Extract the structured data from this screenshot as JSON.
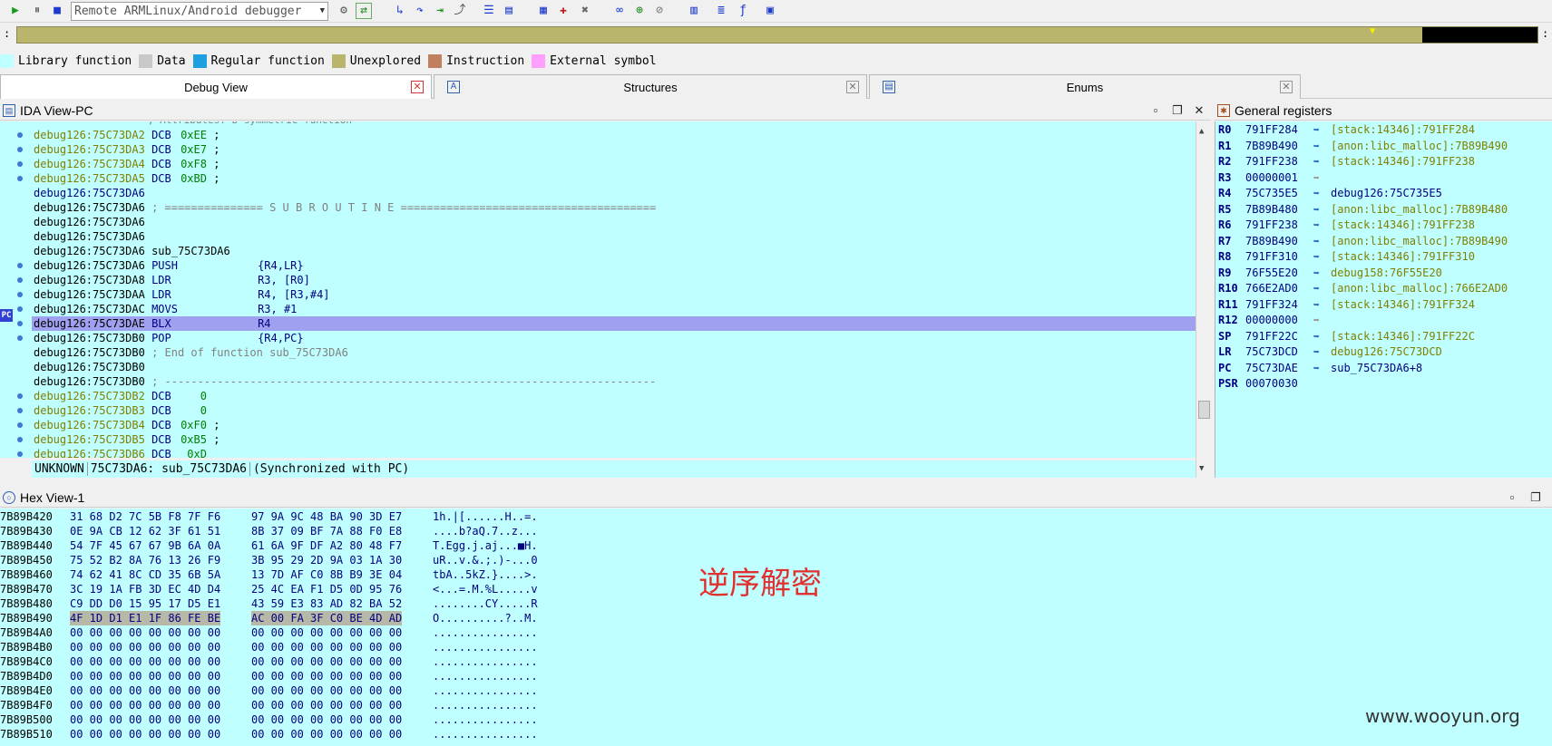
{
  "toolbar": {
    "debugger": "Remote ARMLinux/Android debugger"
  },
  "legend": [
    {
      "label": "Library function",
      "color": "#c0ffff"
    },
    {
      "label": "Data",
      "color": "#c8c8c8"
    },
    {
      "label": "Regular function",
      "color": "#1ea0e0"
    },
    {
      "label": "Unexplored",
      "color": "#b9b56c"
    },
    {
      "label": "Instruction",
      "color": "#c08060"
    },
    {
      "label": "External symbol",
      "color": "#ffa0ff"
    }
  ],
  "tabs": [
    {
      "label": "Debug View",
      "active": true
    },
    {
      "label": "Structures",
      "active": false
    },
    {
      "label": "Enums",
      "active": false
    }
  ],
  "ida_view": {
    "title": "IDA View-PC",
    "pc_badge": "PC",
    "lines": [
      {
        "addr": "debug126:75C73DA2",
        "mn": "DCB",
        "op": "0xEE",
        "tail": " ;",
        "style": "olive",
        "dot": true
      },
      {
        "addr": "debug126:75C73DA3",
        "mn": "DCB",
        "op": "0xE7",
        "tail": " ;",
        "style": "olive",
        "dot": true
      },
      {
        "addr": "debug126:75C73DA4",
        "mn": "DCB",
        "op": "0xF8",
        "tail": " ;",
        "style": "olive",
        "dot": true
      },
      {
        "addr": "debug126:75C73DA5",
        "mn": "DCB",
        "op": "0xBD",
        "tail": " ;",
        "style": "olive",
        "dot": true
      },
      {
        "addr": "debug126:75C73DA6",
        "mn": "",
        "op": "",
        "tail": "",
        "style": "dark-addr",
        "dot": false
      },
      {
        "addr": "debug126:75C73DA6",
        "comment": "; =============== S U B R O U T I N E =======================================",
        "style": "black",
        "dot": false
      },
      {
        "addr": "debug126:75C73DA6",
        "mn": "",
        "op": "",
        "tail": "",
        "style": "black",
        "dot": false
      },
      {
        "addr": "debug126:75C73DA6",
        "mn": "",
        "op": "",
        "tail": "",
        "style": "black",
        "dot": false
      },
      {
        "addr": "debug126:75C73DA6",
        "label": "sub_75C73DA6",
        "style": "black",
        "dot": false
      },
      {
        "addr": "debug126:75C73DA6",
        "mn": "PUSH",
        "op": "{R4,LR}",
        "style": "black",
        "dot": true
      },
      {
        "addr": "debug126:75C73DA8",
        "mn": "LDR",
        "op": "R3, [R0]",
        "style": "black",
        "dot": true
      },
      {
        "addr": "debug126:75C73DAA",
        "mn": "LDR",
        "op": "R4, [R3,#4]",
        "style": "black",
        "dot": true
      },
      {
        "addr": "debug126:75C73DAC",
        "mn": "MOVS",
        "op": "R3, #1",
        "style": "black",
        "dot": true
      },
      {
        "addr": "debug126:75C73DAE",
        "mn": "BLX",
        "op": "R4",
        "style": "black",
        "dot": true,
        "pc": true
      },
      {
        "addr": "debug126:75C73DB0",
        "mn": "POP",
        "op": "{R4,PC}",
        "style": "black",
        "dot": true
      },
      {
        "addr": "debug126:75C73DB0",
        "comment": "; End of function sub_75C73DA6",
        "style": "black",
        "dot": false
      },
      {
        "addr": "debug126:75C73DB0",
        "mn": "",
        "op": "",
        "tail": "",
        "style": "black",
        "dot": false
      },
      {
        "addr": "debug126:75C73DB0",
        "comment": "; ---------------------------------------------------------------------------",
        "style": "black",
        "dot": false
      },
      {
        "addr": "debug126:75C73DB2",
        "mn": "DCB",
        "op": "   0",
        "tail": "",
        "style": "olive",
        "dot": true
      },
      {
        "addr": "debug126:75C73DB3",
        "mn": "DCB",
        "op": "   0",
        "tail": "",
        "style": "olive",
        "dot": true
      },
      {
        "addr": "debug126:75C73DB4",
        "mn": "DCB",
        "op": "0xF0",
        "tail": " ;",
        "style": "olive",
        "dot": true
      },
      {
        "addr": "debug126:75C73DB5",
        "mn": "DCB",
        "op": "0xB5",
        "tail": " ;",
        "style": "olive",
        "dot": true
      },
      {
        "addr": "debug126:75C73DB6",
        "mn": "DCB",
        "op": " 0xD",
        "tail": "",
        "style": "olive",
        "dot": true
      }
    ],
    "status": {
      "seg": "UNKNOWN",
      "loc": "75C73DA6: sub_75C73DA6",
      "sync": "(Synchronized with PC)"
    }
  },
  "registers": {
    "title": "General registers",
    "rows": [
      {
        "name": "R0",
        "value": "791FF284",
        "target": "[stack:14346]:791FF284",
        "style": "olive"
      },
      {
        "name": "R1",
        "value": "7B89B490",
        "target": "[anon:libc_malloc]:7B89B490",
        "style": "olive"
      },
      {
        "name": "R2",
        "value": "791FF238",
        "target": "[stack:14346]:791FF238",
        "style": "olive"
      },
      {
        "name": "R3",
        "value": "00000001",
        "target": "",
        "style": "grey"
      },
      {
        "name": "R4",
        "value": "75C735E5",
        "target": "debug126:75C735E5",
        "style": "dark"
      },
      {
        "name": "R5",
        "value": "7B89B480",
        "target": "[anon:libc_malloc]:7B89B480",
        "style": "olive"
      },
      {
        "name": "R6",
        "value": "791FF238",
        "target": "[stack:14346]:791FF238",
        "style": "olive"
      },
      {
        "name": "R7",
        "value": "7B89B490",
        "target": "[anon:libc_malloc]:7B89B490",
        "style": "olive"
      },
      {
        "name": "R8",
        "value": "791FF310",
        "target": "[stack:14346]:791FF310",
        "style": "olive"
      },
      {
        "name": "R9",
        "value": "76F55E20",
        "target": "debug158:76F55E20",
        "style": "olive"
      },
      {
        "name": "R10",
        "value": "766E2AD0",
        "target": "[anon:libc_malloc]:766E2AD0",
        "style": "olive"
      },
      {
        "name": "R11",
        "value": "791FF324",
        "target": "[stack:14346]:791FF324",
        "style": "olive"
      },
      {
        "name": "R12",
        "value": "00000000",
        "target": "",
        "style": "grey"
      },
      {
        "name": "SP",
        "value": "791FF22C",
        "target": "[stack:14346]:791FF22C",
        "style": "olive"
      },
      {
        "name": "LR",
        "value": "75C73DCD",
        "target": "debug126:75C73DCD",
        "style": "olive"
      },
      {
        "name": "PC",
        "value": "75C73DAE",
        "target": "sub_75C73DA6+8",
        "style": "dark"
      },
      {
        "name": "PSR",
        "value": "00070030",
        "target": "",
        "style": "none"
      }
    ]
  },
  "hex_view": {
    "title": "Hex View-1",
    "rows": [
      {
        "addr": "7B89B420",
        "h1": "31 68 D2 7C 5B F8 7F F6",
        "h2": "97 9A 9C 48 BA 90 3D E7",
        "ascii": "1h.|[......H..=."
      },
      {
        "addr": "7B89B430",
        "h1": "0E 9A CB 12 62 3F 61 51",
        "h2": "8B 37 09 BF 7A 88 F0 E8",
        "ascii": "....b?aQ.7..z..."
      },
      {
        "addr": "7B89B440",
        "h1": "54 7F 45 67 67 9B 6A 0A",
        "h2": "61 6A 9F DF A2 80 48 F7",
        "ascii": "T.Egg.j.aj...■H."
      },
      {
        "addr": "7B89B450",
        "h1": "75 52 B2 8A 76 13 26 F9",
        "h2": "3B 95 29 2D 9A 03 1A 30",
        "ascii": "uR..v.&.;.)-...0"
      },
      {
        "addr": "7B89B460",
        "h1": "74 62 41 8C CD 35 6B 5A",
        "h2": "13 7D AF C0 8B B9 3E 04",
        "ascii": "tbA..5kZ.}....>."
      },
      {
        "addr": "7B89B470",
        "h1": "3C 19 1A FB 3D EC 4D D4",
        "h2": "25 4C EA F1 D5 0D 95 76",
        "ascii": "<...=.M.%L.....v"
      },
      {
        "addr": "7B89B480",
        "h1": "C9 DD D0 15 95 17 D5 E1",
        "h2": "43 59 E3 83 AD 82 BA 52",
        "ascii": "........CY.....R"
      },
      {
        "addr": "7B89B490",
        "h1": "4F 1D D1 E1 1F 86 FE BE",
        "h2": "AC 00 FA 3F C0 BE 4D AD",
        "ascii": "O..........?..M.",
        "selected": true
      },
      {
        "addr": "7B89B4A0",
        "h1": "00 00 00 00 00 00 00 00",
        "h2": "00 00 00 00 00 00 00 00",
        "ascii": "................"
      },
      {
        "addr": "7B89B4B0",
        "h1": "00 00 00 00 00 00 00 00",
        "h2": "00 00 00 00 00 00 00 00",
        "ascii": "................"
      },
      {
        "addr": "7B89B4C0",
        "h1": "00 00 00 00 00 00 00 00",
        "h2": "00 00 00 00 00 00 00 00",
        "ascii": "................"
      },
      {
        "addr": "7B89B4D0",
        "h1": "00 00 00 00 00 00 00 00",
        "h2": "00 00 00 00 00 00 00 00",
        "ascii": "................"
      },
      {
        "addr": "7B89B4E0",
        "h1": "00 00 00 00 00 00 00 00",
        "h2": "00 00 00 00 00 00 00 00",
        "ascii": "................"
      },
      {
        "addr": "7B89B4F0",
        "h1": "00 00 00 00 00 00 00 00",
        "h2": "00 00 00 00 00 00 00 00",
        "ascii": "................"
      },
      {
        "addr": "7B89B500",
        "h1": "00 00 00 00 00 00 00 00",
        "h2": "00 00 00 00 00 00 00 00",
        "ascii": "................"
      },
      {
        "addr": "7B89B510",
        "h1": "00 00 00 00 00 00 00 00",
        "h2": "00 00 00 00 00 00 00 00",
        "ascii": "................"
      }
    ]
  },
  "annotation": "逆序解密",
  "watermark": "www.wooyun.org"
}
